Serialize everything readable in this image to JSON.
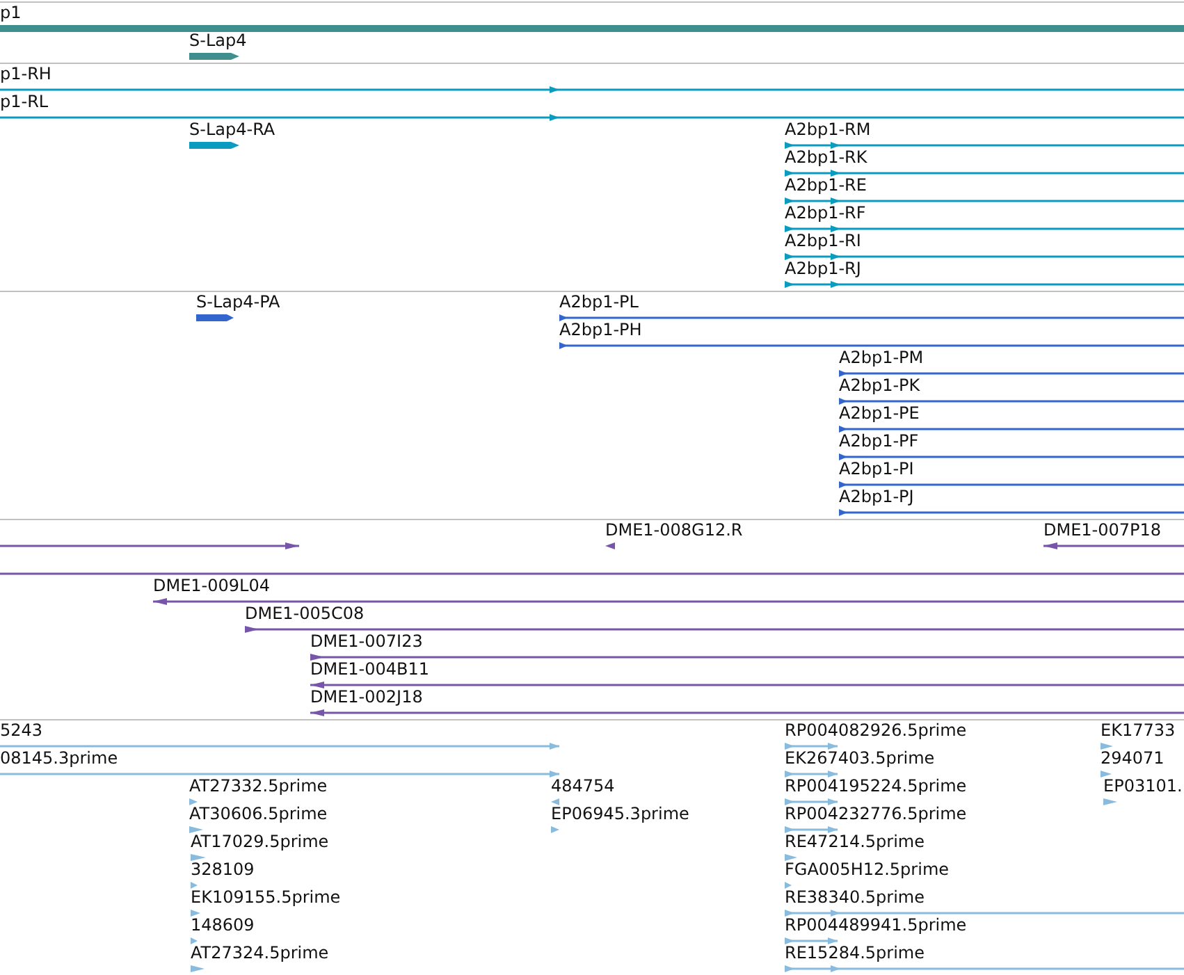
{
  "tracks": [
    {
      "kind": "gene",
      "lanes": [
        {
          "features": [
            {
              "label": "p1",
              "kind": "bar"
            }
          ]
        },
        {
          "features": [
            {
              "label": "S-Lap4",
              "kind": "bar",
              "reverse": false
            }
          ]
        }
      ]
    },
    {
      "kind": "transcript",
      "lanes": [
        {
          "features": [
            {
              "label": "p1-RH",
              "kind": "line",
              "reverse": false
            }
          ]
        },
        {
          "features": [
            {
              "label": "p1-RL",
              "kind": "line",
              "reverse": false
            }
          ]
        },
        {
          "features": [
            {
              "label": "S-Lap4-RA",
              "kind": "bar",
              "reverse": false
            },
            {
              "label": "A2bp1-RM",
              "kind": "line",
              "reverse": false
            }
          ]
        },
        {
          "features": [
            {
              "label": "A2bp1-RK",
              "kind": "line",
              "reverse": false
            }
          ]
        },
        {
          "features": [
            {
              "label": "A2bp1-RE",
              "kind": "line",
              "reverse": false
            }
          ]
        },
        {
          "features": [
            {
              "label": "A2bp1-RF",
              "kind": "line",
              "reverse": false
            }
          ]
        },
        {
          "features": [
            {
              "label": "A2bp1-RI",
              "kind": "line",
              "reverse": false
            }
          ]
        },
        {
          "features": [
            {
              "label": "A2bp1-RJ",
              "kind": "line",
              "reverse": false
            }
          ]
        }
      ]
    },
    {
      "kind": "protein",
      "lanes": [
        {
          "features": [
            {
              "label": "S-Lap4-PA",
              "kind": "bar",
              "reverse": false
            },
            {
              "label": "A2bp1-PL",
              "kind": "line",
              "reverse": false
            }
          ]
        },
        {
          "features": [
            {
              "label": "A2bp1-PH",
              "kind": "line",
              "reverse": false
            }
          ]
        },
        {
          "features": [
            {
              "label": "A2bp1-PM",
              "kind": "line",
              "reverse": false
            }
          ]
        },
        {
          "features": [
            {
              "label": "A2bp1-PK",
              "kind": "line",
              "reverse": false
            }
          ]
        },
        {
          "features": [
            {
              "label": "A2bp1-PE",
              "kind": "line",
              "reverse": false
            }
          ]
        },
        {
          "features": [
            {
              "label": "A2bp1-PF",
              "kind": "line",
              "reverse": false
            }
          ]
        },
        {
          "features": [
            {
              "label": "A2bp1-PI",
              "kind": "line",
              "reverse": false
            }
          ]
        },
        {
          "features": [
            {
              "label": "A2bp1-PJ",
              "kind": "line",
              "reverse": false
            }
          ]
        }
      ]
    },
    {
      "kind": "clone",
      "lanes": [
        {
          "features": [
            {
              "kind": "line",
              "reverse": false
            },
            {
              "label": "DME1-008G12.R",
              "kind": "mark",
              "reverse": true
            },
            {
              "label": "DME1-007P18",
              "kind": "line",
              "reverse": true
            }
          ]
        },
        {
          "features": [
            {
              "kind": "line"
            }
          ]
        },
        {
          "features": [
            {
              "label": "DME1-009L04",
              "kind": "line",
              "reverse": true
            }
          ]
        },
        {
          "features": [
            {
              "label": "DME1-005C08",
              "kind": "line",
              "reverse": false
            }
          ]
        },
        {
          "features": [
            {
              "label": "DME1-007I23",
              "kind": "line",
              "reverse": false
            }
          ]
        },
        {
          "features": [
            {
              "label": "DME1-004B11",
              "kind": "line",
              "reverse": true
            }
          ]
        },
        {
          "features": [
            {
              "label": "DME1-002J18",
              "kind": "line",
              "reverse": true
            }
          ]
        }
      ]
    },
    {
      "kind": "est",
      "lanes": [
        {
          "features": [
            {
              "label": "5243",
              "kind": "line",
              "reverse": false
            },
            {
              "label": "RP004082926.5prime",
              "kind": "line",
              "reverse": false
            },
            {
              "label": "EK17733",
              "kind": "mark",
              "reverse": false
            }
          ]
        },
        {
          "features": [
            {
              "label": "08145.3prime",
              "kind": "line",
              "reverse": false
            },
            {
              "label": "EK267403.5prime",
              "kind": "line",
              "reverse": false
            },
            {
              "label": "294071",
              "kind": "mark",
              "reverse": false
            }
          ]
        },
        {
          "features": [
            {
              "label": "AT27332.5prime",
              "kind": "mark",
              "reverse": false
            },
            {
              "label": "484754",
              "kind": "mark",
              "reverse": true
            },
            {
              "label": "RP004195224.5prime",
              "kind": "line",
              "reverse": false
            },
            {
              "label": "EP03101.",
              "kind": "mark",
              "reverse": false
            }
          ]
        },
        {
          "features": [
            {
              "label": "AT30606.5prime",
              "kind": "mark",
              "reverse": false
            },
            {
              "label": "EP06945.3prime",
              "kind": "mark",
              "reverse": false
            },
            {
              "label": "RP004232776.5prime",
              "kind": "line",
              "reverse": false
            }
          ]
        },
        {
          "features": [
            {
              "label": "AT17029.5prime",
              "kind": "mark",
              "reverse": false
            },
            {
              "label": "RE47214.5prime",
              "kind": "mark",
              "reverse": false
            }
          ]
        },
        {
          "features": [
            {
              "label": "328109",
              "kind": "mark",
              "reverse": false
            },
            {
              "label": "FGA005H12.5prime",
              "kind": "mark",
              "reverse": false
            }
          ]
        },
        {
          "features": [
            {
              "label": "EK109155.5prime",
              "kind": "mark",
              "reverse": false
            },
            {
              "label": "RE38340.5prime",
              "kind": "line",
              "reverse": false
            }
          ]
        },
        {
          "features": [
            {
              "label": "148609",
              "kind": "mark",
              "reverse": false
            },
            {
              "label": "RP004489941.5prime",
              "kind": "line",
              "reverse": false
            }
          ]
        },
        {
          "features": [
            {
              "label": "AT27324.5prime",
              "kind": "mark",
              "reverse": false
            },
            {
              "label": "RE15284.5prime",
              "kind": "line",
              "reverse": false
            }
          ]
        }
      ]
    }
  ]
}
